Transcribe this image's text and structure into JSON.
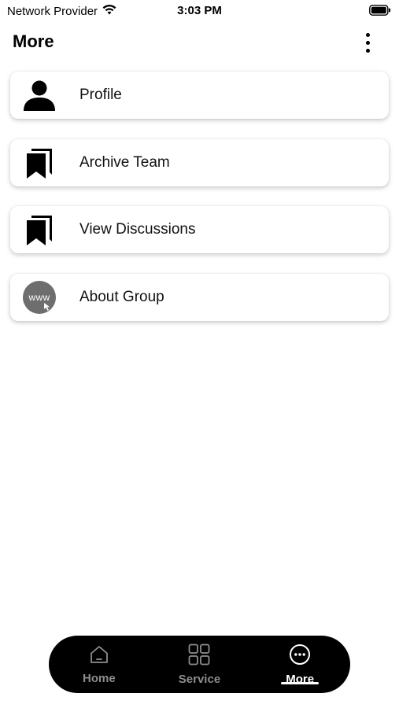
{
  "status_bar": {
    "carrier": "Network Provider",
    "time": "3:03 PM",
    "wifi_icon": "wifi-icon",
    "battery_icon": "battery-icon"
  },
  "header": {
    "title": "More",
    "overflow_icon": "more-vertical-icon"
  },
  "menu": {
    "items": [
      {
        "label": "Profile",
        "icon": "person-icon"
      },
      {
        "label": "Archive Team",
        "icon": "bookmarks-icon"
      },
      {
        "label": "View Discussions",
        "icon": "bookmarks-icon"
      },
      {
        "label": "About Group",
        "icon": "www-globe-icon",
        "badge_text": "www"
      }
    ]
  },
  "tab_bar": {
    "tabs": [
      {
        "label": "Home",
        "icon": "home-icon",
        "active": false
      },
      {
        "label": "Service",
        "icon": "grid-icon",
        "active": false
      },
      {
        "label": "More",
        "icon": "more-horizontal-circle-icon",
        "active": true
      }
    ]
  },
  "colors": {
    "tab_bar_bg": "#000000",
    "tab_inactive": "#8d8d8d",
    "tab_active": "#ffffff",
    "www_badge_bg": "#6e6e6e"
  }
}
